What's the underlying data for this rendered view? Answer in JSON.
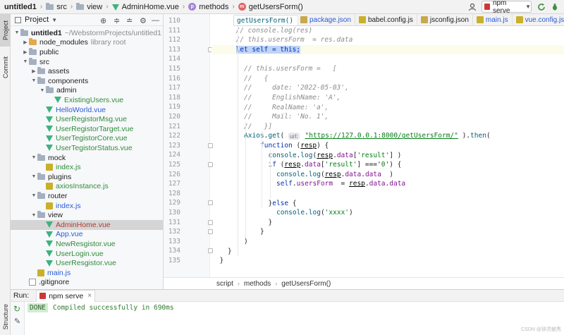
{
  "navbar": {
    "crumbs": [
      "untitled1",
      "src",
      "view",
      "AdminHome.vue",
      "methods",
      "getUsersForm()"
    ],
    "run_config": "npm serve"
  },
  "left_strip": {
    "project": "Project",
    "commit": "Commit",
    "structure": "Structure"
  },
  "project": {
    "title": "Project",
    "tree": [
      {
        "label": "untitled1",
        "extra": "~/WebstormProjects/untitled1",
        "type": "folder",
        "depth": 0,
        "open": true,
        "bold": true
      },
      {
        "label": "node_modules",
        "extra": "library root",
        "type": "folder-orange",
        "depth": 1,
        "open": false
      },
      {
        "label": "public",
        "type": "folder",
        "depth": 1,
        "open": false
      },
      {
        "label": "src",
        "type": "folder",
        "depth": 1,
        "open": true
      },
      {
        "label": "assets",
        "type": "folder",
        "depth": 2,
        "open": false
      },
      {
        "label": "components",
        "type": "folder",
        "depth": 2,
        "open": true
      },
      {
        "label": "admin",
        "type": "folder",
        "depth": 3,
        "open": true
      },
      {
        "label": "ExistingUsers.vue",
        "type": "vue",
        "depth": 4,
        "color": "green"
      },
      {
        "label": "HelloWorld.vue",
        "type": "vue",
        "depth": 3,
        "color": "blue"
      },
      {
        "label": "UserRegistorMsg.vue",
        "type": "vue",
        "depth": 3,
        "color": "green"
      },
      {
        "label": "UserRegistorTarget.vue",
        "type": "vue",
        "depth": 3,
        "color": "green"
      },
      {
        "label": "UserTegistorCore.vue",
        "type": "vue",
        "depth": 3,
        "color": "green"
      },
      {
        "label": "UserTegistorStatus.vue",
        "type": "vue",
        "depth": 3,
        "color": "green"
      },
      {
        "label": "mock",
        "type": "folder",
        "depth": 2,
        "open": true
      },
      {
        "label": "index.js",
        "type": "js",
        "depth": 3,
        "color": "green"
      },
      {
        "label": "plugins",
        "type": "folder",
        "depth": 2,
        "open": true
      },
      {
        "label": "axiosInstance.js",
        "type": "js",
        "depth": 3,
        "color": "green"
      },
      {
        "label": "router",
        "type": "folder",
        "depth": 2,
        "open": true
      },
      {
        "label": "index.js",
        "type": "js",
        "depth": 3,
        "color": "blue"
      },
      {
        "label": "view",
        "type": "folder",
        "depth": 2,
        "open": true
      },
      {
        "label": "AdminHome.vue",
        "type": "vue",
        "depth": 3,
        "color": "red",
        "selected": true
      },
      {
        "label": "App.vue",
        "type": "vue",
        "depth": 3,
        "color": "blue"
      },
      {
        "label": "NewResgistor.vue",
        "type": "vue",
        "depth": 3,
        "color": "green"
      },
      {
        "label": "UserLogin.vue",
        "type": "vue",
        "depth": 3,
        "color": "green"
      },
      {
        "label": "UserResgistor.vue",
        "type": "vue",
        "depth": 3,
        "color": "green"
      },
      {
        "label": "main.js",
        "type": "js",
        "depth": 2,
        "color": "blue"
      },
      {
        "label": ".gitignore",
        "type": "git",
        "depth": 1,
        "color": "plain"
      }
    ]
  },
  "editor": {
    "header_hint": "getUsersForm() {",
    "tabs": [
      {
        "label": "package.json",
        "color": "blue"
      },
      {
        "label": "babel.config.js",
        "color": "plain"
      },
      {
        "label": "jsconfig.json",
        "color": "plain"
      },
      {
        "label": "main.js",
        "color": "blue"
      },
      {
        "label": "vue.config.js",
        "color": "blue"
      }
    ],
    "lines": [
      {
        "n": "110",
        "indent": 0,
        "parts": [
          [
            "",
            ""
          ]
        ]
      },
      {
        "n": "111",
        "indent": 3,
        "parts": [
          [
            "c",
            "// console.log(res)"
          ]
        ]
      },
      {
        "n": "112",
        "indent": 3,
        "parts": [
          [
            "c",
            "// this.usersForm  = res.data"
          ]
        ]
      },
      {
        "n": "113",
        "indent": 3,
        "cur": true,
        "parts": [
          [
            "khl",
            "let self = this;"
          ]
        ]
      },
      {
        "n": "114",
        "indent": 0,
        "parts": [
          [
            "",
            ""
          ]
        ]
      },
      {
        "n": "115",
        "indent": 4,
        "parts": [
          [
            "c",
            "// this.usersForm =   ["
          ]
        ]
      },
      {
        "n": "116",
        "indent": 4,
        "parts": [
          [
            "c",
            "//   {"
          ]
        ]
      },
      {
        "n": "117",
        "indent": 4,
        "parts": [
          [
            "c",
            "//     date: '2022-05-03',"
          ]
        ]
      },
      {
        "n": "118",
        "indent": 4,
        "parts": [
          [
            "c",
            "//     EnglishName: 'A',"
          ]
        ]
      },
      {
        "n": "119",
        "indent": 4,
        "parts": [
          [
            "c",
            "//     RealName: 'a',"
          ]
        ]
      },
      {
        "n": "120",
        "indent": 4,
        "parts": [
          [
            "c",
            "//     Mail: 'No. 1',"
          ]
        ]
      },
      {
        "n": "121",
        "indent": 4,
        "parts": [
          [
            "c",
            "//   }]"
          ]
        ]
      },
      {
        "n": "122",
        "indent": 4,
        "parts": [
          [
            "f",
            "Axios"
          ],
          [
            "",
            "."
          ],
          [
            "f",
            "get"
          ],
          [
            "",
            "( "
          ],
          [
            "hint",
            "url:"
          ],
          [
            "",
            " "
          ],
          [
            "ul",
            "\"https://127.0.0.1:8000/getUsersForm/\""
          ],
          [
            "",
            " )."
          ],
          [
            "f",
            "then"
          ],
          [
            "",
            "("
          ]
        ]
      },
      {
        "n": "123",
        "indent": 6,
        "parts": [
          [
            "k",
            "function"
          ],
          [
            "",
            " ("
          ],
          [
            "v",
            "resp"
          ],
          [
            "",
            ") {"
          ]
        ]
      },
      {
        "n": "124",
        "indent": 7,
        "parts": [
          [
            "f",
            "console"
          ],
          [
            "",
            "."
          ],
          [
            "f",
            "log"
          ],
          [
            "",
            "("
          ],
          [
            "v",
            "resp"
          ],
          [
            "",
            "."
          ],
          [
            "p",
            "data"
          ],
          [
            "",
            "["
          ],
          [
            "s",
            "'result'"
          ],
          [
            "",
            "] )"
          ]
        ]
      },
      {
        "n": "125",
        "indent": 7,
        "parts": [
          [
            "k",
            "if"
          ],
          [
            "",
            " ("
          ],
          [
            "v",
            "resp"
          ],
          [
            "",
            "."
          ],
          [
            "p",
            "data"
          ],
          [
            "",
            "["
          ],
          [
            "s",
            "'result'"
          ],
          [
            "",
            "] ==='"
          ],
          [
            "s",
            "0"
          ],
          [
            "",
            "') {"
          ]
        ]
      },
      {
        "n": "126",
        "indent": 8,
        "parts": [
          [
            "f",
            "console"
          ],
          [
            "",
            "."
          ],
          [
            "f",
            "log"
          ],
          [
            "",
            "("
          ],
          [
            "v",
            "resp"
          ],
          [
            "",
            "."
          ],
          [
            "p",
            "data"
          ],
          [
            "",
            "."
          ],
          [
            "p",
            "data"
          ],
          [
            "",
            "  )"
          ]
        ]
      },
      {
        "n": "127",
        "indent": 8,
        "parts": [
          [
            "k",
            "self"
          ],
          [
            "",
            "."
          ],
          [
            "p",
            "usersForm"
          ],
          [
            "",
            "  = "
          ],
          [
            "v",
            "resp"
          ],
          [
            "",
            "."
          ],
          [
            "p",
            "data"
          ],
          [
            "",
            "."
          ],
          [
            "p",
            "data"
          ]
        ]
      },
      {
        "n": "128",
        "indent": 0,
        "parts": [
          [
            "",
            ""
          ]
        ]
      },
      {
        "n": "129",
        "indent": 7,
        "parts": [
          [
            "",
            "}"
          ],
          [
            "k",
            "else"
          ],
          [
            "",
            " {"
          ]
        ]
      },
      {
        "n": "130",
        "indent": 8,
        "parts": [
          [
            "f",
            "console"
          ],
          [
            "",
            "."
          ],
          [
            "f",
            "log"
          ],
          [
            "",
            "("
          ],
          [
            "s",
            "'xxxx'"
          ],
          [
            "",
            ")"
          ]
        ]
      },
      {
        "n": "131",
        "indent": 7,
        "parts": [
          [
            "",
            "}"
          ]
        ]
      },
      {
        "n": "132",
        "indent": 6,
        "parts": [
          [
            "",
            "}"
          ]
        ]
      },
      {
        "n": "133",
        "indent": 4,
        "parts": [
          [
            "",
            ")"
          ]
        ]
      },
      {
        "n": "134",
        "indent": 2,
        "parts": [
          [
            "",
            "}"
          ]
        ]
      },
      {
        "n": "135",
        "indent": 1,
        "parts": [
          [
            "",
            "}"
          ]
        ]
      }
    ],
    "breadcrumbs": [
      "script",
      "methods",
      "getUsersForm()"
    ]
  },
  "run": {
    "label": "Run:",
    "tab": "npm serve",
    "status": "DONE",
    "message": "Compiled successfully in 690ms"
  },
  "watermark": "CSDN @钟灵毓秀"
}
